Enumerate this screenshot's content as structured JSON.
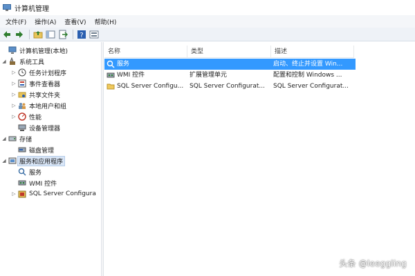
{
  "window": {
    "title": "计算机管理"
  },
  "menu": [
    "文件(F)",
    "操作(A)",
    "查看(V)",
    "帮助(H)"
  ],
  "toolbar": {
    "icons": [
      "back-arrow-icon",
      "forward-arrow-icon",
      "up-folder-icon",
      "show-hide-tree-icon",
      "export-list-icon",
      "help-icon",
      "properties-icon"
    ]
  },
  "tree": [
    {
      "label": "计算机管理(本地)",
      "level": 0,
      "arrow": "",
      "icon": "computer-icon"
    },
    {
      "label": "系统工具",
      "level": 1,
      "arrow": "◢",
      "icon": "tools-icon"
    },
    {
      "label": "任务计划程序",
      "level": 2,
      "arrow": "▷",
      "icon": "clock-icon"
    },
    {
      "label": "事件查看器",
      "level": 2,
      "arrow": "▷",
      "icon": "event-viewer-icon"
    },
    {
      "label": "共享文件夹",
      "level": 2,
      "arrow": "▷",
      "icon": "shared-folder-icon"
    },
    {
      "label": "本地用户和组",
      "level": 2,
      "arrow": "▷",
      "icon": "users-icon"
    },
    {
      "label": "性能",
      "level": 2,
      "arrow": "▷",
      "icon": "performance-icon"
    },
    {
      "label": "设备管理器",
      "level": 2,
      "arrow": "",
      "icon": "device-manager-icon"
    },
    {
      "label": "存储",
      "level": 1,
      "arrow": "◢",
      "icon": "storage-icon"
    },
    {
      "label": "磁盘管理",
      "level": 2,
      "arrow": "",
      "icon": "disk-icon"
    },
    {
      "label": "服务和应用程序",
      "level": 1,
      "arrow": "◢",
      "icon": "services-apps-icon",
      "selected": true
    },
    {
      "label": "服务",
      "level": 2,
      "arrow": "",
      "icon": "services-icon"
    },
    {
      "label": "WMI 控件",
      "level": 2,
      "arrow": "",
      "icon": "wmi-icon"
    },
    {
      "label": "SQL Server Configura",
      "level": 2,
      "arrow": "▷",
      "icon": "sql-config-icon"
    }
  ],
  "list": {
    "columns": [
      "名称",
      "类型",
      "描述"
    ],
    "rows": [
      {
        "name": "服务",
        "type": "",
        "desc": "启动、终止并设置 Win...",
        "icon": "services-icon",
        "selected": true
      },
      {
        "name": "WMI 控件",
        "type": "扩展管理单元",
        "desc": "配置和控制 Windows ...",
        "icon": "wmi-icon"
      },
      {
        "name": "SQL Server Configu...",
        "type": "SQL Server Configurat...",
        "desc": "SQL Server Configurat...",
        "icon": "folder-icon"
      }
    ]
  },
  "watermark": "头条 @leeggling",
  "colors": {
    "selection": "#3399ff",
    "tree_selection": "#d9e6f7",
    "toolbar_bg": "#eef2f7"
  }
}
